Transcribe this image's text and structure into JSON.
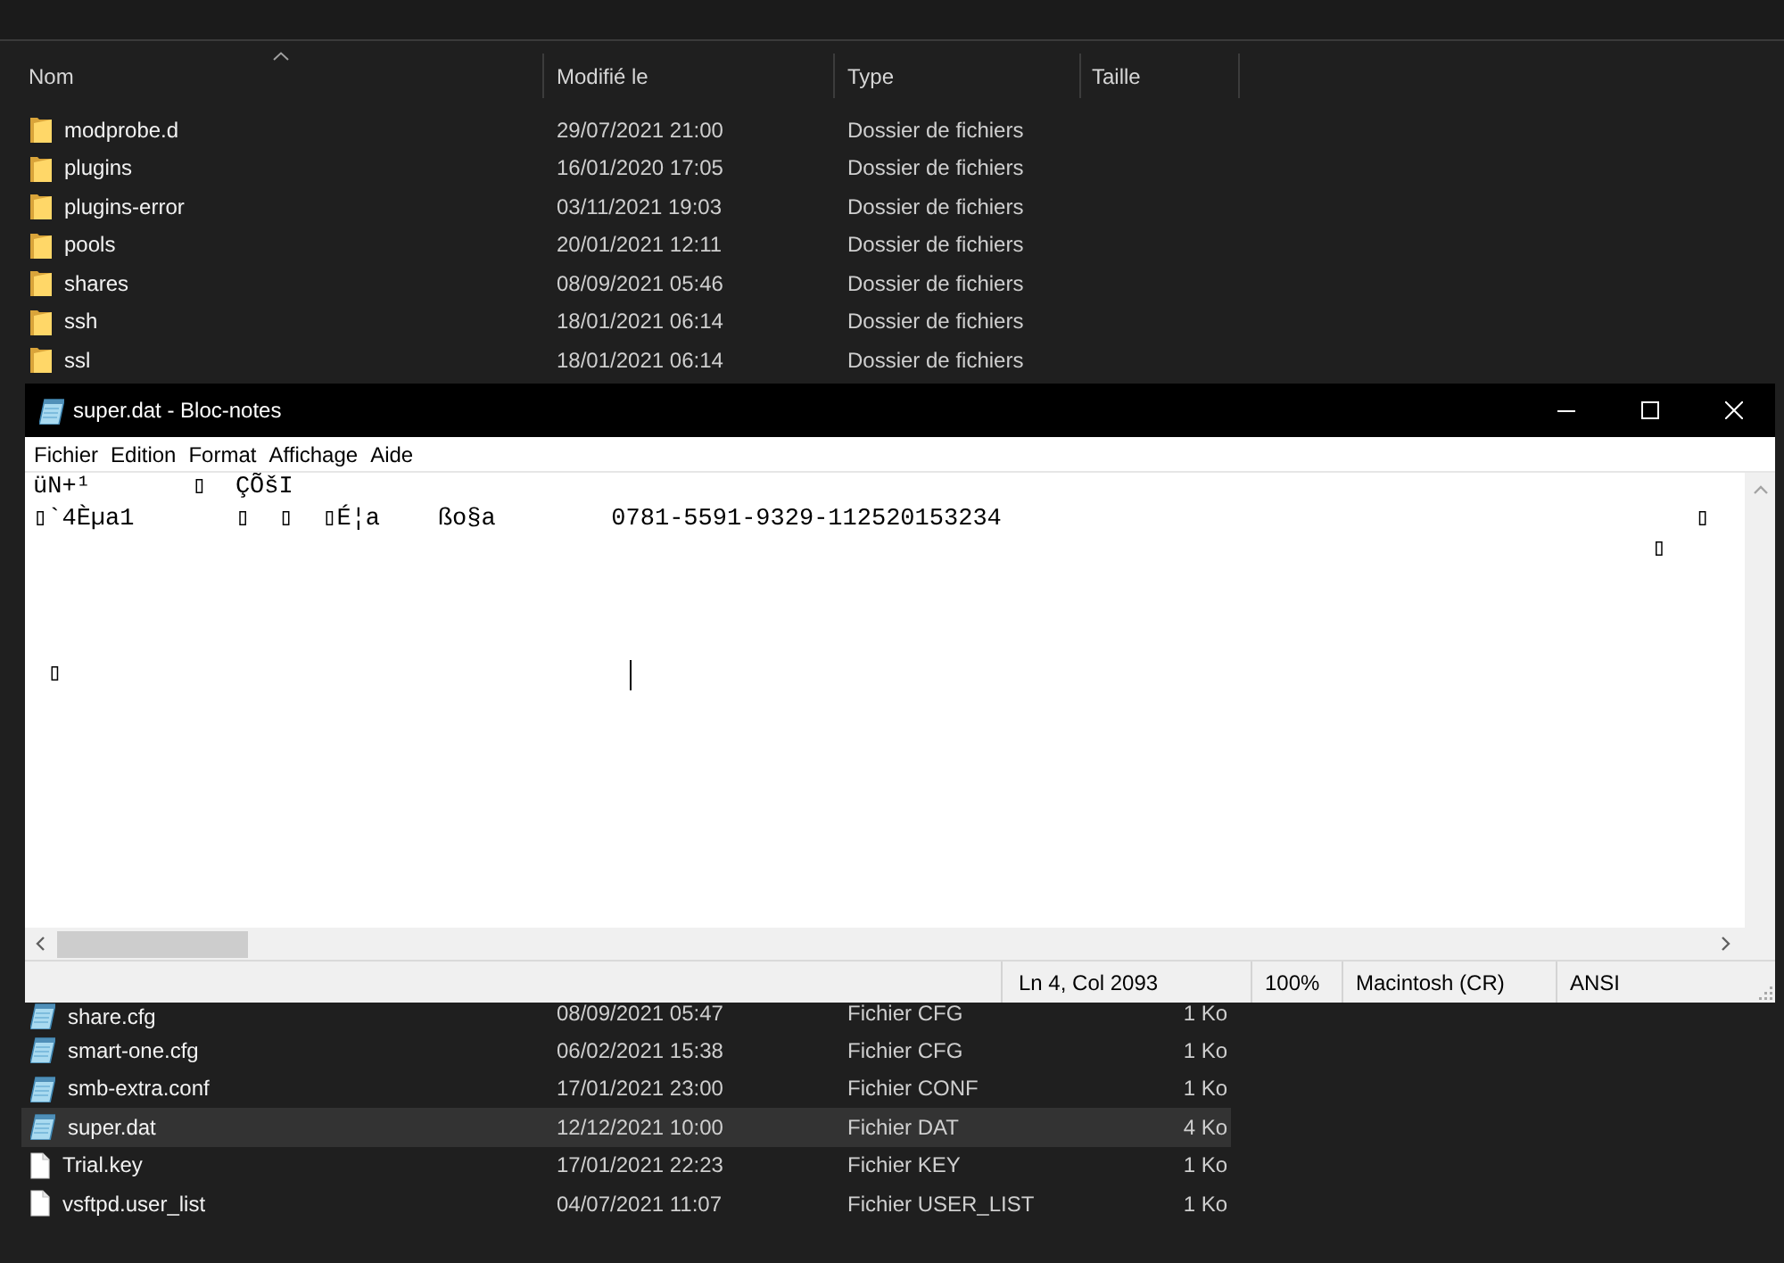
{
  "explorer": {
    "columns": [
      {
        "label": "Nom",
        "sorted": true
      },
      {
        "label": "Modifié le",
        "sorted": false
      },
      {
        "label": "Type",
        "sorted": false
      },
      {
        "label": "Taille",
        "sorted": false
      }
    ],
    "rows_above": [
      {
        "kind": "folder",
        "name": "modprobe.d",
        "modified": "29/07/2021 21:00",
        "type": "Dossier de fichiers",
        "selected": false
      },
      {
        "kind": "folder",
        "name": "plugins",
        "modified": "16/01/2020 17:05",
        "type": "Dossier de fichiers",
        "selected": false
      },
      {
        "kind": "folder",
        "name": "plugins-error",
        "modified": "03/11/2021 19:03",
        "type": "Dossier de fichiers",
        "selected": false
      },
      {
        "kind": "folder",
        "name": "pools",
        "modified": "20/01/2021 12:11",
        "type": "Dossier de fichiers",
        "selected": false
      },
      {
        "kind": "folder",
        "name": "shares",
        "modified": "08/09/2021 05:46",
        "type": "Dossier de fichiers",
        "selected": false
      },
      {
        "kind": "folder",
        "name": "ssh",
        "modified": "18/01/2021 06:14",
        "type": "Dossier de fichiers",
        "selected": false
      },
      {
        "kind": "folder",
        "name": "ssl",
        "modified": "18/01/2021 06:14",
        "type": "Dossier de fichiers",
        "selected": false
      }
    ],
    "rows_below": [
      {
        "kind": "text-file",
        "name": "share.cfg",
        "modified": "08/09/2021 05:47",
        "type": "Fichier CFG",
        "size": "1 Ko",
        "selected": false
      },
      {
        "kind": "text-file",
        "name": "smart-one.cfg",
        "modified": "06/02/2021 15:38",
        "type": "Fichier CFG",
        "size": "1 Ko",
        "selected": false
      },
      {
        "kind": "text-file",
        "name": "smb-extra.conf",
        "modified": "17/01/2021 23:00",
        "type": "Fichier CONF",
        "size": "1 Ko",
        "selected": false
      },
      {
        "kind": "text-file",
        "name": "super.dat",
        "modified": "12/12/2021 10:00",
        "type": "Fichier DAT",
        "size": "4 Ko",
        "selected": true
      },
      {
        "kind": "file",
        "name": "Trial.key",
        "modified": "17/01/2021 22:23",
        "type": "Fichier KEY",
        "size": "1 Ko",
        "selected": false
      },
      {
        "kind": "file",
        "name": "vsftpd.user_list",
        "modified": "04/07/2021 11:07",
        "type": "Fichier USER_LIST",
        "size": "1 Ko",
        "selected": false
      }
    ]
  },
  "notepad": {
    "title": "super.dat - Bloc-notes",
    "menu": [
      "Fichier",
      "Edition",
      "Format",
      "Affichage",
      "Aide"
    ],
    "text": "üN+¹       ▯  ÇÕšI\n▯`4Èµa1       ▯  ▯  ▯É¦a    ßo§a        0781-5591-9329-112520153234                                                ▯\n                                                                                                                ▯\n\n\n\n ▯",
    "status": [
      "Ln 4, Col 2093",
      "100%",
      "Macintosh (CR)",
      "ANSI"
    ]
  }
}
